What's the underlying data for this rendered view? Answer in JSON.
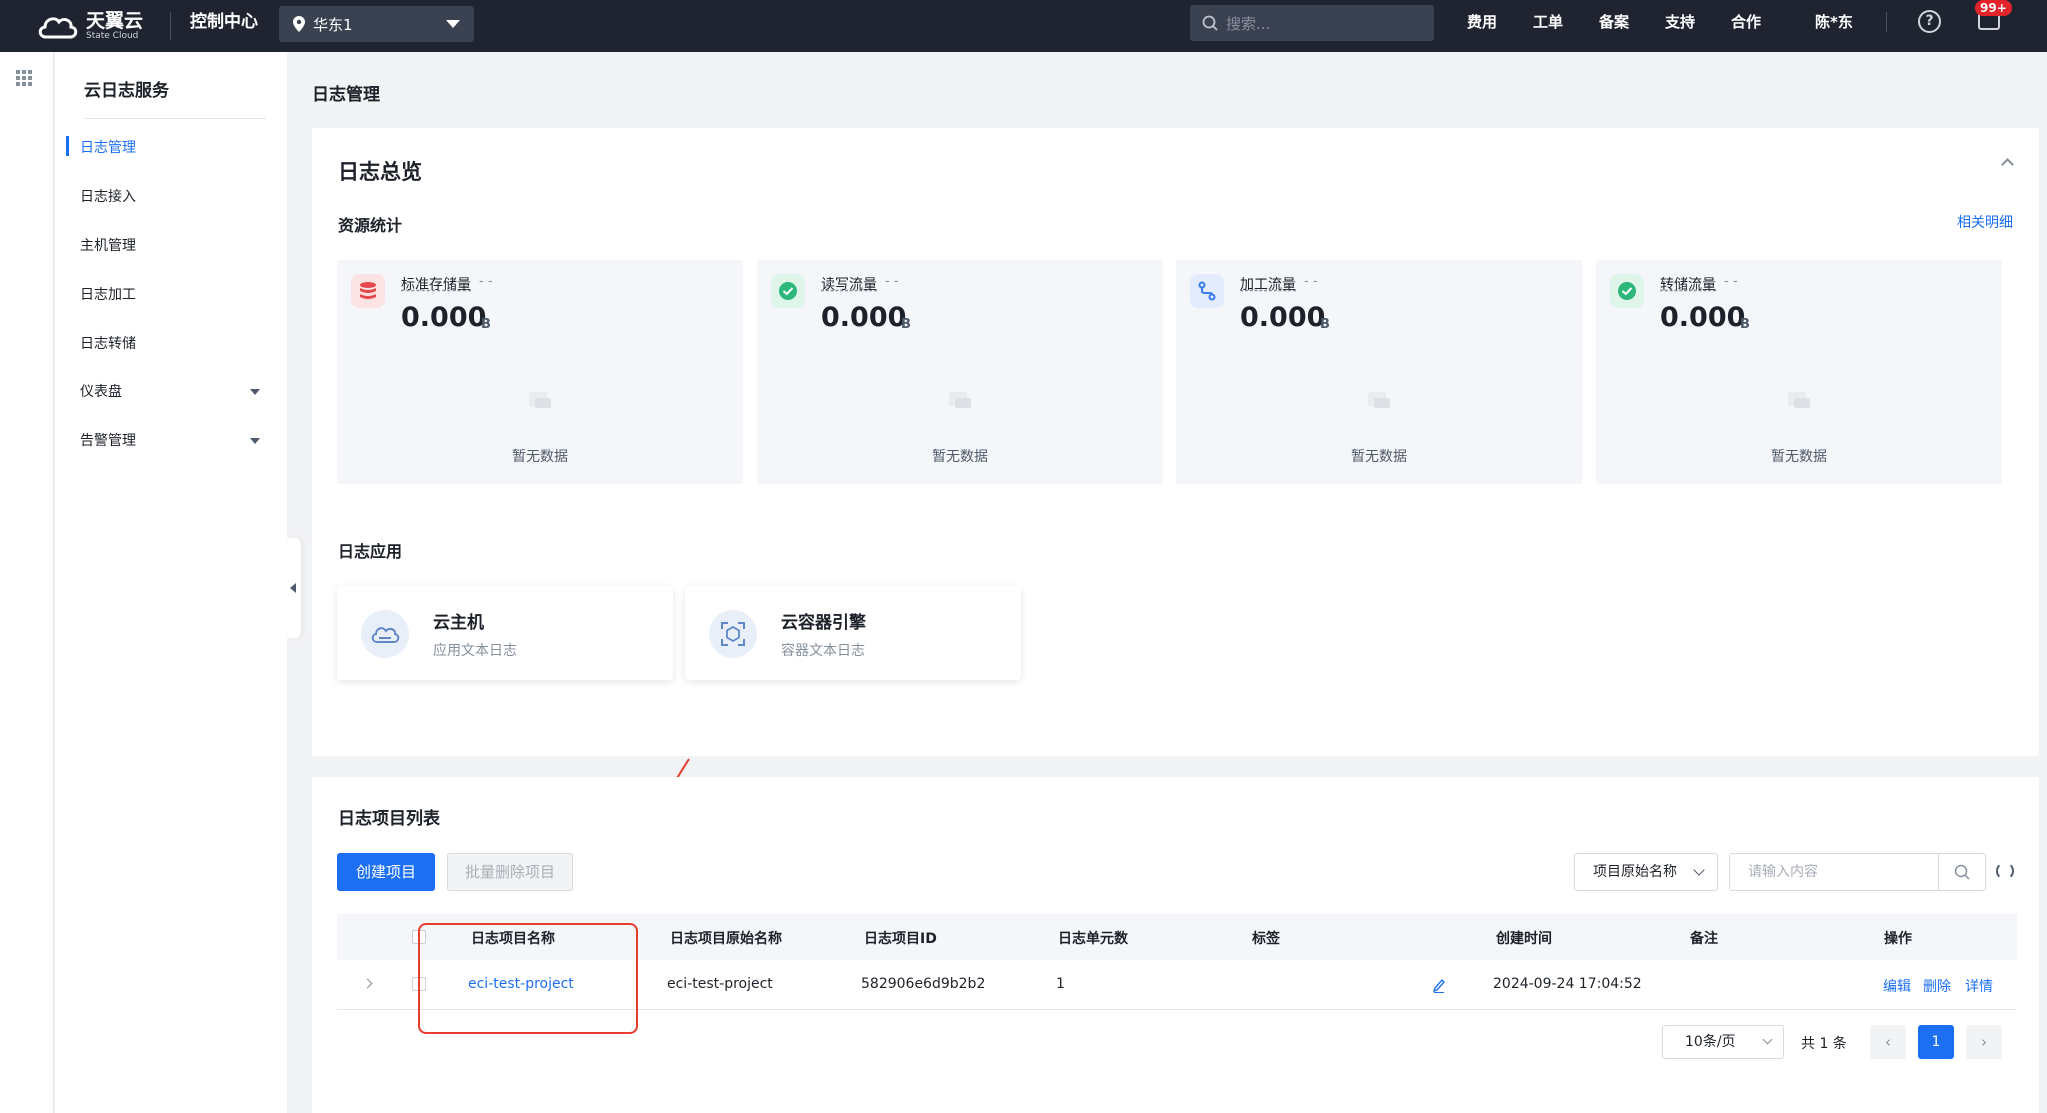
{
  "topbar": {
    "brand": "天翼云",
    "brand_sub": "State Cloud",
    "console": "控制中心",
    "region": "华东1",
    "search_placeholder": "搜索...",
    "nav": [
      "费用",
      "工单",
      "备案",
      "支持",
      "合作"
    ],
    "user": "陈*东",
    "help": "?",
    "badge": "99+"
  },
  "sidenav": {
    "service": "云日志服务",
    "items": [
      {
        "label": "日志管理",
        "active": true
      },
      {
        "label": "日志接入"
      },
      {
        "label": "主机管理"
      },
      {
        "label": "日志加工"
      },
      {
        "label": "日志转储"
      },
      {
        "label": "仪表盘",
        "expandable": true
      },
      {
        "label": "告警管理",
        "expandable": true
      }
    ]
  },
  "page": {
    "title": "日志管理"
  },
  "overview": {
    "title": "日志总览",
    "resource_title": "资源统计",
    "related_link": "相关明细",
    "stats": [
      {
        "label": "标准存储量",
        "suffix": "- -",
        "value": "0.000",
        "unit": "B",
        "empty": "暂无数据",
        "icon": "database-icon",
        "color": "#e5484d"
      },
      {
        "label": "读写流量",
        "suffix": "- -",
        "value": "0.000",
        "unit": "B",
        "empty": "暂无数据",
        "icon": "check-circle-icon",
        "color": "#2db77b"
      },
      {
        "label": "加工流量",
        "suffix": "- -",
        "value": "0.000",
        "unit": "B",
        "empty": "暂无数据",
        "icon": "process-icon",
        "color": "#3b7cf0"
      },
      {
        "label": "转储流量",
        "suffix": "- -",
        "value": "0.000",
        "unit": "B",
        "empty": "暂无数据",
        "icon": "check-circle-icon",
        "color": "#2db77b"
      }
    ],
    "apps_title": "日志应用",
    "apps": [
      {
        "name": "云主机",
        "desc": "应用文本日志",
        "icon": "cloud-host-icon"
      },
      {
        "name": "云容器引擎",
        "desc": "容器文本日志",
        "icon": "container-icon"
      }
    ]
  },
  "projects": {
    "title": "日志项目列表",
    "create_button": "创建项目",
    "batch_delete_button": "批量删除项目",
    "filter_field": "项目原始名称",
    "search_placeholder": "请输入内容",
    "columns": [
      "日志项目名称",
      "日志项目原始名称",
      "日志项目ID",
      "日志单元数",
      "标签",
      "创建时间",
      "备注",
      "操作"
    ],
    "rows": [
      {
        "name": "eci-test-project",
        "original_name": "eci-test-project",
        "id": "582906e6d9b2b2",
        "units": "1",
        "tag": "",
        "created": "2024-09-24 17:04:52",
        "note": "",
        "actions": [
          "编辑",
          "删除",
          "详情"
        ]
      }
    ],
    "pagination": {
      "page_size": "10条/页",
      "total": "共 1 条",
      "current": "1",
      "prev": "‹",
      "next": "›"
    }
  }
}
